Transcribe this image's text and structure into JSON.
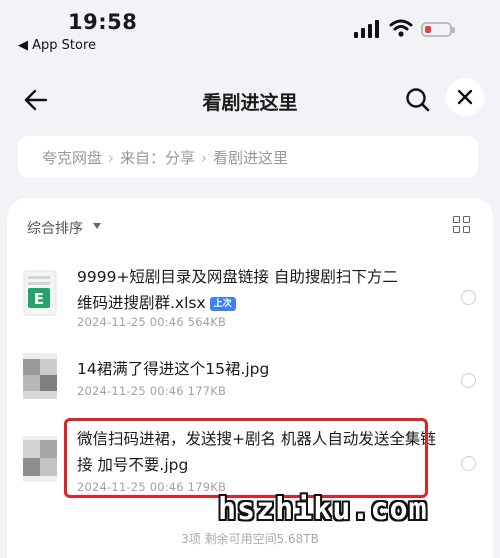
{
  "status_bar": {
    "time": "19:58",
    "back_app": "◀ App Store"
  },
  "navbar": {
    "title": "看剧进这里"
  },
  "breadcrumb": {
    "items": [
      "夸克网盘",
      "来自：分享",
      "看剧进这里"
    ]
  },
  "toolbar": {
    "sort_label": "综合排序"
  },
  "files": [
    {
      "name": "9999+短剧目录及网盘链接 自助搜剧扫下方二维码进搜剧群.xlsx",
      "badge": "上次",
      "meta": "2024-11-25 00:46  564KB"
    },
    {
      "name": "14裙满了得进这个15裙.jpg",
      "meta": "2024-11-25 00:46  177KB"
    },
    {
      "name": "微信扫码进裙，发送搜+剧名 机器人自动发送全集链接  加号不要.jpg",
      "meta": "2024-11-25 00:46  179KB"
    }
  ],
  "footer": {
    "count_text": "3项 剩余可用空间5.68TB"
  },
  "watermark": "hszhiku.com",
  "colors": {
    "battery_low": "#e8413a",
    "badge": "#3b82f6",
    "highlight": "#e02424",
    "excel_green": "#22a36a"
  }
}
